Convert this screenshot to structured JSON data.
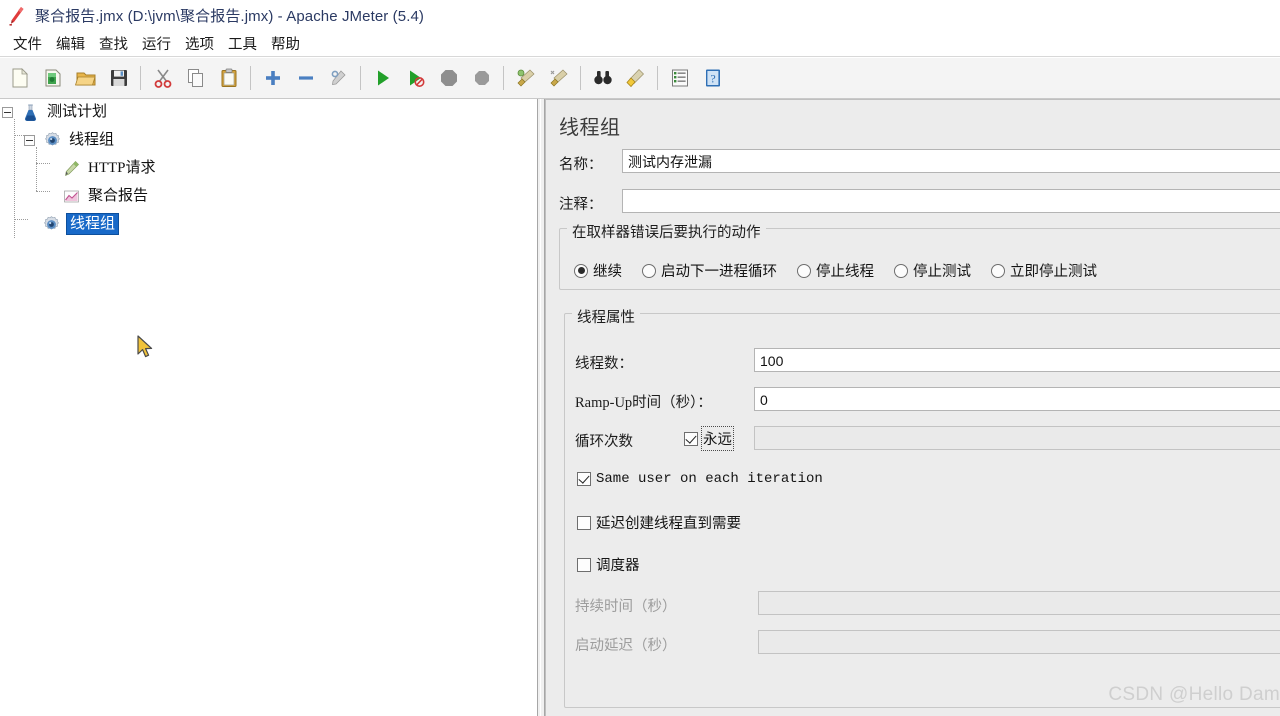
{
  "window": {
    "title": "聚合报告.jmx (D:\\jvm\\聚合报告.jmx) - Apache JMeter (5.4)",
    "logo_icon": "jmeter-feather-icon"
  },
  "menubar": {
    "items": [
      {
        "label": "文件",
        "name": "menu-file"
      },
      {
        "label": "编辑",
        "name": "menu-edit"
      },
      {
        "label": "查找",
        "name": "menu-search"
      },
      {
        "label": "运行",
        "name": "menu-run"
      },
      {
        "label": "选项",
        "name": "menu-options"
      },
      {
        "label": "工具",
        "name": "menu-tools"
      },
      {
        "label": "帮助",
        "name": "menu-help"
      }
    ]
  },
  "toolbar": {
    "buttons": [
      {
        "icon": "new-document-icon",
        "name": "toolbar-new"
      },
      {
        "icon": "templates-icon",
        "name": "toolbar-templates"
      },
      {
        "icon": "open-folder-icon",
        "name": "toolbar-open"
      },
      {
        "icon": "save-floppy-icon",
        "name": "toolbar-save"
      },
      {
        "sep": true
      },
      {
        "icon": "cut-scissors-icon",
        "name": "toolbar-cut"
      },
      {
        "icon": "copy-icon",
        "name": "toolbar-copy"
      },
      {
        "icon": "paste-clipboard-icon",
        "name": "toolbar-paste"
      },
      {
        "sep": true
      },
      {
        "icon": "plus-icon",
        "name": "toolbar-expand-all"
      },
      {
        "icon": "minus-icon",
        "name": "toolbar-collapse-all"
      },
      {
        "icon": "toggle-icon",
        "name": "toolbar-toggle"
      },
      {
        "sep": true
      },
      {
        "icon": "play-green-icon",
        "name": "toolbar-start"
      },
      {
        "icon": "play-no-timers-icon",
        "name": "toolbar-start-no-pauses"
      },
      {
        "icon": "stop-icon",
        "name": "toolbar-stop"
      },
      {
        "icon": "shutdown-icon",
        "name": "toolbar-shutdown"
      },
      {
        "sep": true
      },
      {
        "icon": "clear-broom-icon",
        "name": "toolbar-clear"
      },
      {
        "icon": "clear-all-broom-icon",
        "name": "toolbar-clear-all"
      },
      {
        "sep": true
      },
      {
        "icon": "search-binoculars-icon",
        "name": "toolbar-search"
      },
      {
        "icon": "reset-search-icon",
        "name": "toolbar-reset-search"
      },
      {
        "sep": true
      },
      {
        "icon": "function-helper-icon",
        "name": "toolbar-function-helper"
      },
      {
        "icon": "help-icon",
        "name": "toolbar-help"
      }
    ]
  },
  "tree": {
    "nodes": [
      {
        "label": "测试计划",
        "icon": "test-plan-icon",
        "selected": false,
        "expandable": true
      },
      {
        "label": "线程组",
        "icon": "thread-group-gear-icon",
        "selected": false,
        "expandable": true
      },
      {
        "label": "HTTP请求",
        "icon": "http-request-icon",
        "selected": false,
        "expandable": false
      },
      {
        "label": "聚合报告",
        "icon": "aggregate-report-chart-icon",
        "selected": false,
        "expandable": false
      },
      {
        "label": "线程组",
        "icon": "thread-group-gear-icon",
        "selected": true,
        "expandable": false
      }
    ]
  },
  "panel": {
    "title": "线程组",
    "name_label": "名称：",
    "name_value": "测试内存泄漏",
    "comment_label": "注释：",
    "comment_value": "",
    "error_action": {
      "legend": "在取样器错误后要执行的动作",
      "options": [
        {
          "label": "继续",
          "selected": true
        },
        {
          "label": "启动下一进程循环",
          "selected": false
        },
        {
          "label": "停止线程",
          "selected": false
        },
        {
          "label": "停止测试",
          "selected": false
        },
        {
          "label": "立即停止测试",
          "selected": false
        }
      ]
    },
    "thread_properties": {
      "legend": "线程属性",
      "num_threads_label": "线程数：",
      "num_threads_value": "100",
      "ramp_up_label": "Ramp-Up时间（秒）：",
      "ramp_up_value": "0",
      "loop_count_label": "循环次数",
      "forever_label": "永远",
      "forever_checked": true,
      "loop_count_value": "",
      "same_user_label": "Same user on each iteration",
      "same_user_checked": true,
      "delayed_start_label": "延迟创建线程直到需要",
      "delayed_start_checked": false,
      "scheduler_label": "调度器",
      "scheduler_checked": false,
      "duration_label": "持续时间（秒）",
      "duration_value": "",
      "startup_delay_label": "启动延迟（秒）",
      "startup_delay_value": ""
    }
  },
  "watermark": {
    "text": "CSDN @Hello Dam"
  },
  "colors": {
    "selection_blue": "#1869c8",
    "panel_bg": "#ececec",
    "title_text": "#2b3a63"
  }
}
